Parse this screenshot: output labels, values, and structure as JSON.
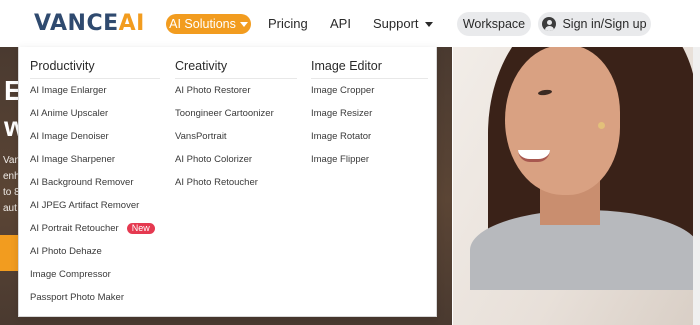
{
  "header": {
    "logo_main": "VANCE",
    "logo_accent": "AI",
    "nav": {
      "solutions": "AI Solutions",
      "pricing": "Pricing",
      "api": "API",
      "support": "Support"
    },
    "workspace": "Workspace",
    "signin": "Sign in/Sign up"
  },
  "hero": {
    "big_line1": "E",
    "big_line2": "w",
    "small_lines": [
      "Van",
      "enh",
      "to 8",
      "aut"
    ]
  },
  "menu": {
    "productivity": {
      "title": "Productivity",
      "items": [
        "AI Image Enlarger",
        "AI Anime Upscaler",
        "AI Image Denoiser",
        "AI Image Sharpener",
        "AI Background Remover",
        "AI JPEG Artifact Remover",
        "AI Portrait Retoucher",
        "AI Photo Dehaze",
        "Image Compressor",
        "Passport Photo Maker"
      ],
      "badge": "New"
    },
    "creativity": {
      "title": "Creativity",
      "items": [
        "AI Photo Restorer",
        "Toongineer Cartoonizer",
        "VansPortrait",
        "AI Photo Colorizer",
        "AI Photo Retoucher"
      ]
    },
    "editor": {
      "title": "Image Editor",
      "items": [
        "Image Cropper",
        "Image Resizer",
        "Image Rotator",
        "Image Flipper"
      ]
    }
  },
  "colors": {
    "brand_orange": "#f29c1f",
    "brand_navy": "#2f4a6f",
    "badge_red": "#e53950"
  }
}
